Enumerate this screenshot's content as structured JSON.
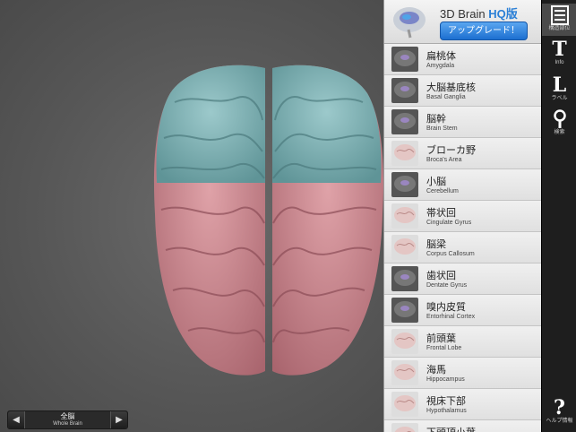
{
  "app": {
    "title_main": "3D Brain ",
    "title_hq": "HQ版",
    "upgrade_label": "アップグレード！"
  },
  "bottom_nav": {
    "label_jp": "全脳",
    "label_en": "Whole Brain",
    "prev_icon": "◀",
    "next_icon": "▶"
  },
  "structures": [
    {
      "jp": "扁桃体",
      "en": "Amygdala",
      "thumb": "dark"
    },
    {
      "jp": "大脳基底核",
      "en": "Basal Ganglia",
      "thumb": "dark"
    },
    {
      "jp": "脳幹",
      "en": "Brain Stem",
      "thumb": "dark"
    },
    {
      "jp": "ブローカ野",
      "en": "Broca's Area",
      "thumb": "light"
    },
    {
      "jp": "小脳",
      "en": "Cerebellum",
      "thumb": "dark"
    },
    {
      "jp": "帯状回",
      "en": "Cingulate Gyrus",
      "thumb": "light"
    },
    {
      "jp": "脳梁",
      "en": "Corpus Callosum",
      "thumb": "light"
    },
    {
      "jp": "歯状回",
      "en": "Dentate Gyrus",
      "thumb": "dark"
    },
    {
      "jp": "嗅内皮質",
      "en": "Entorhinal Cortex",
      "thumb": "dark"
    },
    {
      "jp": "前頭葉",
      "en": "Frontal Lobe",
      "thumb": "light"
    },
    {
      "jp": "海馬",
      "en": "Hippocampus",
      "thumb": "light"
    },
    {
      "jp": "視床下部",
      "en": "Hypothalamus",
      "thumb": "light"
    },
    {
      "jp": "下頭頂小葉",
      "en": "",
      "thumb": "light"
    }
  ],
  "toolbar": {
    "list": {
      "icon": "list-icon",
      "caption": "構造部位"
    },
    "info": {
      "glyph": "T",
      "caption": "Info"
    },
    "label": {
      "glyph": "L",
      "caption": "ラベル"
    },
    "search": {
      "icon": "magnifier-icon",
      "caption": "検索"
    },
    "help": {
      "glyph": "?",
      "caption": "ヘルプ情報"
    }
  },
  "colors": {
    "frontal_lobe": "#7fb3b5",
    "parietal_lobe": "#c98a92",
    "panel_bg": "#e8e8e8",
    "toolbar_bg": "#1e1e1e",
    "accent_blue": "#2a7fd6"
  }
}
